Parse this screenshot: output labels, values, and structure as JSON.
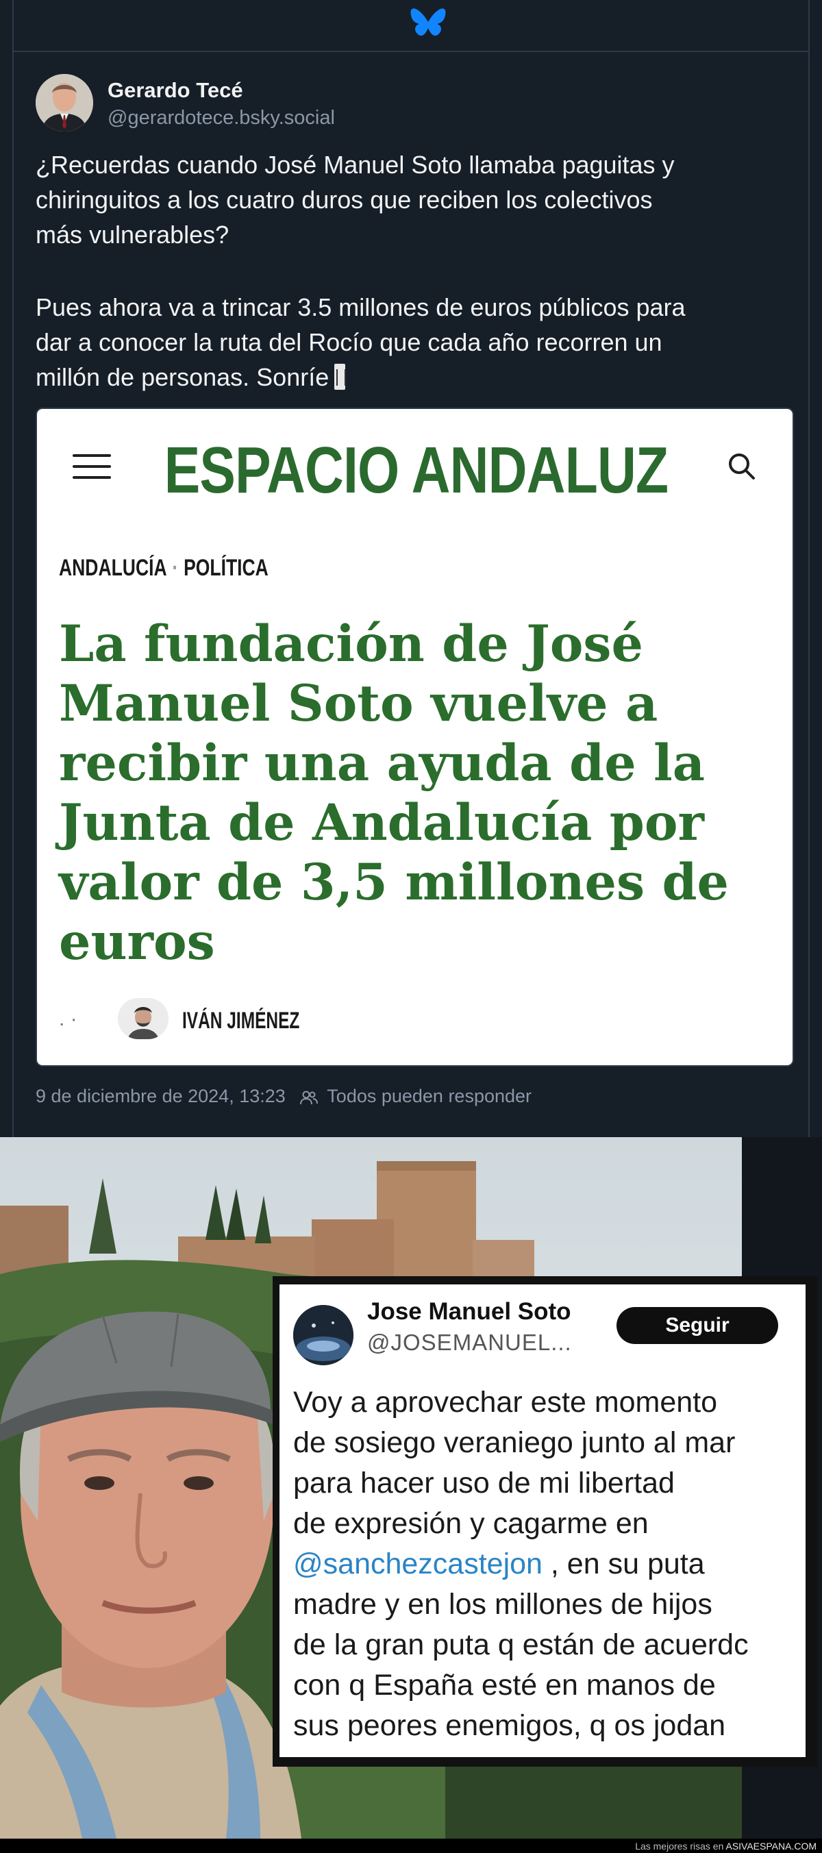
{
  "post": {
    "author_name": "Gerardo Tecé",
    "author_handle": "@gerardotece.bsky.social",
    "paragraph1_lines": [
      "¿Recuerdas cuando José Manuel Soto llamaba paguitas y",
      "chiringuitos a los cuatro duros que reciben los colectivos",
      "más vulnerables?"
    ],
    "paragraph2_lines": [
      "Pues ahora va a trincar 3.5 millones de euros públicos para",
      "dar a conocer la ruta del Rocío que cada año recorren un",
      "millón de personas. Sonríe"
    ],
    "timestamp": "9 de diciembre de 2024, 13:23",
    "reply_setting": "Todos pueden responder"
  },
  "news_card": {
    "site_name": "ESPACIO ANDALUZ",
    "section_1": "ANDALUCÍA",
    "separator": "·",
    "section_2": "POLÍTICA",
    "headline": "La fundación de José\nManuel Soto vuelve a\nrecibir una ayuda de la\nJunta de Andalucía por\nvalor de 3,5 millones de\neuros",
    "byline_dots": ". ·",
    "byline_author": "IVÁN JIMÉNEZ"
  },
  "tweet": {
    "name": "Jose Manuel Soto",
    "handle": "@JOSEMANUEL...",
    "follow_label": "Seguir",
    "lines_before_mention": [
      "Voy a aprovechar este momento",
      "de sosiego veraniego junto al mar",
      "para hacer uso de mi libertad",
      "de expresión y cagarme en"
    ],
    "mention": "@sanchezcastejon",
    "mention_tail": " , en su puta",
    "lines_after_mention": [
      "madre y en los millones de hijos",
      "de la gran puta q están de acuerdc",
      "con q España esté en manos de",
      "sus peores enemigos, q os jodan"
    ]
  },
  "footer": {
    "tagline": "Las mejores risas en ",
    "site": "ASIVAESPANA.COM"
  },
  "icons": {
    "app_logo": "butterfly-icon",
    "menu": "menu-icon",
    "search": "search-icon",
    "reply_audience": "people-icon"
  },
  "colors": {
    "post_background": "#161e27",
    "brand_blue": "#1185fe",
    "news_green": "#2a6d2c",
    "mention_blue": "#2a84c6"
  }
}
